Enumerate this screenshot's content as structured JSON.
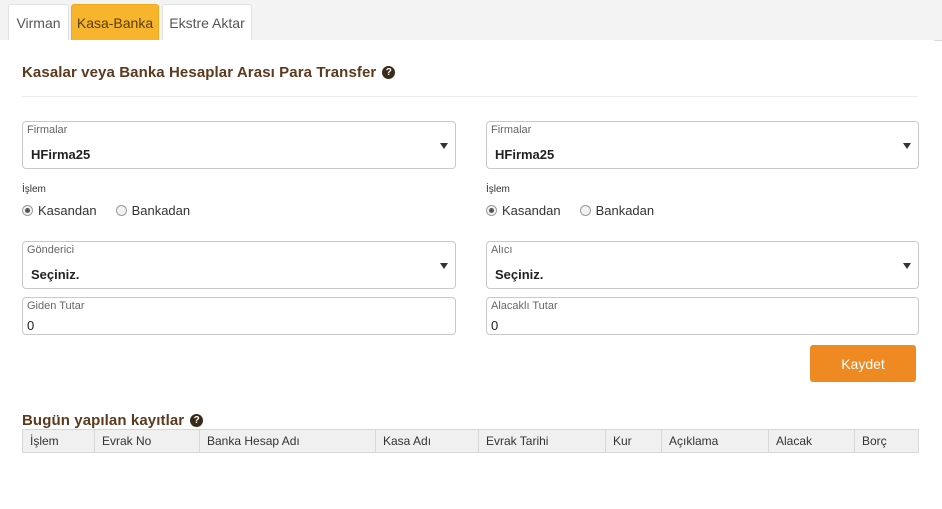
{
  "tabs": [
    {
      "label": "Virman",
      "active": false
    },
    {
      "label": "Kasa-Banka",
      "active": true
    },
    {
      "label": "Ekstre Aktar",
      "active": false
    }
  ],
  "transfer_section": {
    "title": "Kasalar veya Banka Hesaplar Arası Para Transfer",
    "help_icon": "question-circle-icon"
  },
  "left": {
    "firma": {
      "label": "Firmalar",
      "value": "HFirma25"
    },
    "islem_label": "İşlem",
    "radios": [
      {
        "label": "Kasandan",
        "checked": true
      },
      {
        "label": "Bankadan",
        "checked": false
      }
    ],
    "party": {
      "label": "Gönderici",
      "value": "Seçiniz."
    },
    "amount": {
      "label": "Giden Tutar",
      "value": "0"
    }
  },
  "right": {
    "firma": {
      "label": "Firmalar",
      "value": "HFirma25"
    },
    "islem_label": "İşlem",
    "radios": [
      {
        "label": "Kasandan",
        "checked": true
      },
      {
        "label": "Bankadan",
        "checked": false
      }
    ],
    "party": {
      "label": "Alıcı",
      "value": "Seçiniz."
    },
    "amount": {
      "label": "Alacaklı Tutar",
      "value": "0"
    }
  },
  "save_button": {
    "label": "Kaydet"
  },
  "records_section": {
    "title": "Bugün yapılan kayıtlar",
    "help_icon": "question-circle-icon",
    "columns": [
      "İşlem",
      "Evrak No",
      "Banka Hesap Adı",
      "Kasa Adı",
      "Evrak Tarihi",
      "Kur",
      "Açıklama",
      "Alacak",
      "Borç"
    ]
  },
  "colors": {
    "active_tab": "#f6b52d",
    "title": "#5b3a1f",
    "save_button": "#ef8a23"
  }
}
